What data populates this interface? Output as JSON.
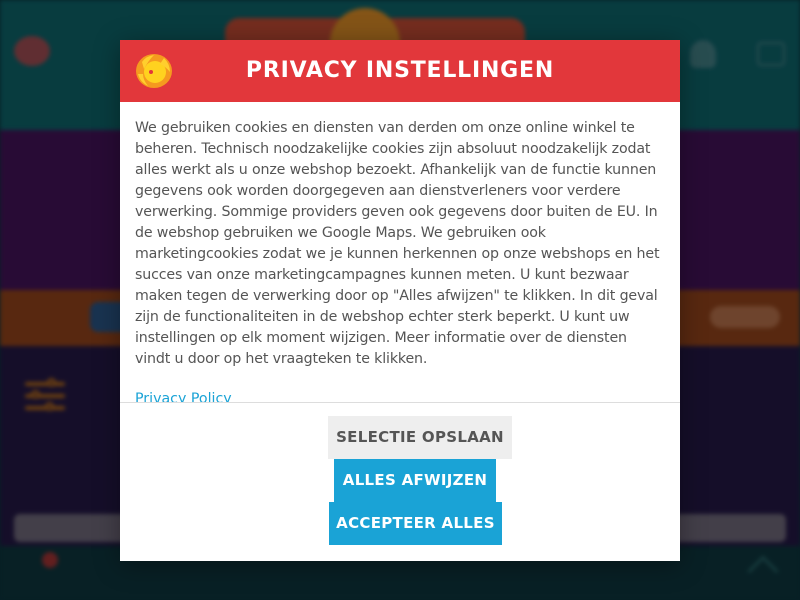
{
  "modal": {
    "title": "PRIVACY INSTELLINGEN",
    "logo_icon": "shop-logo-icon",
    "body_text": "We gebruiken cookies en diensten van derden om onze online winkel te beheren. Technisch noodzakelijke cookies zijn absoluut noodzakelijk zodat alles werkt als u onze webshop bezoekt. Afhankelijk van de functie kunnen gegevens ook worden doorgegeven aan dienstverleners voor verdere verwerking. Sommige providers geven ook gegevens door buiten de EU. In de webshop gebruiken we Google Maps. We gebruiken ook marketingcookies zodat we je kunnen herkennen op onze webshops en het succes van onze marketingcampagnes kunnen meten. U kunt bezwaar maken tegen de verwerking door op \"Alles afwijzen\" te klikken. In dit geval zijn de functionaliteiten in de webshop echter sterk beperkt. U kunt uw instellingen op elk moment wijzigen. Meer informatie over de diensten vindt u door op het vraagteken te klikken.",
    "privacy_link": "Privacy Policy",
    "buttons": {
      "save": "SELECTIE OPSLAAN",
      "reject": "ALLES AFWIJZEN",
      "accept": "ACCEPTEER ALLES"
    }
  },
  "colors": {
    "header": "#e2373b",
    "primary_button": "#1aa3d6",
    "secondary_button": "#eeeeee",
    "link": "#1aa3d6",
    "text": "#555555"
  },
  "background_icons": [
    "avatar",
    "user-icon",
    "cart-icon",
    "filter-icon",
    "back-to-top-icon"
  ]
}
